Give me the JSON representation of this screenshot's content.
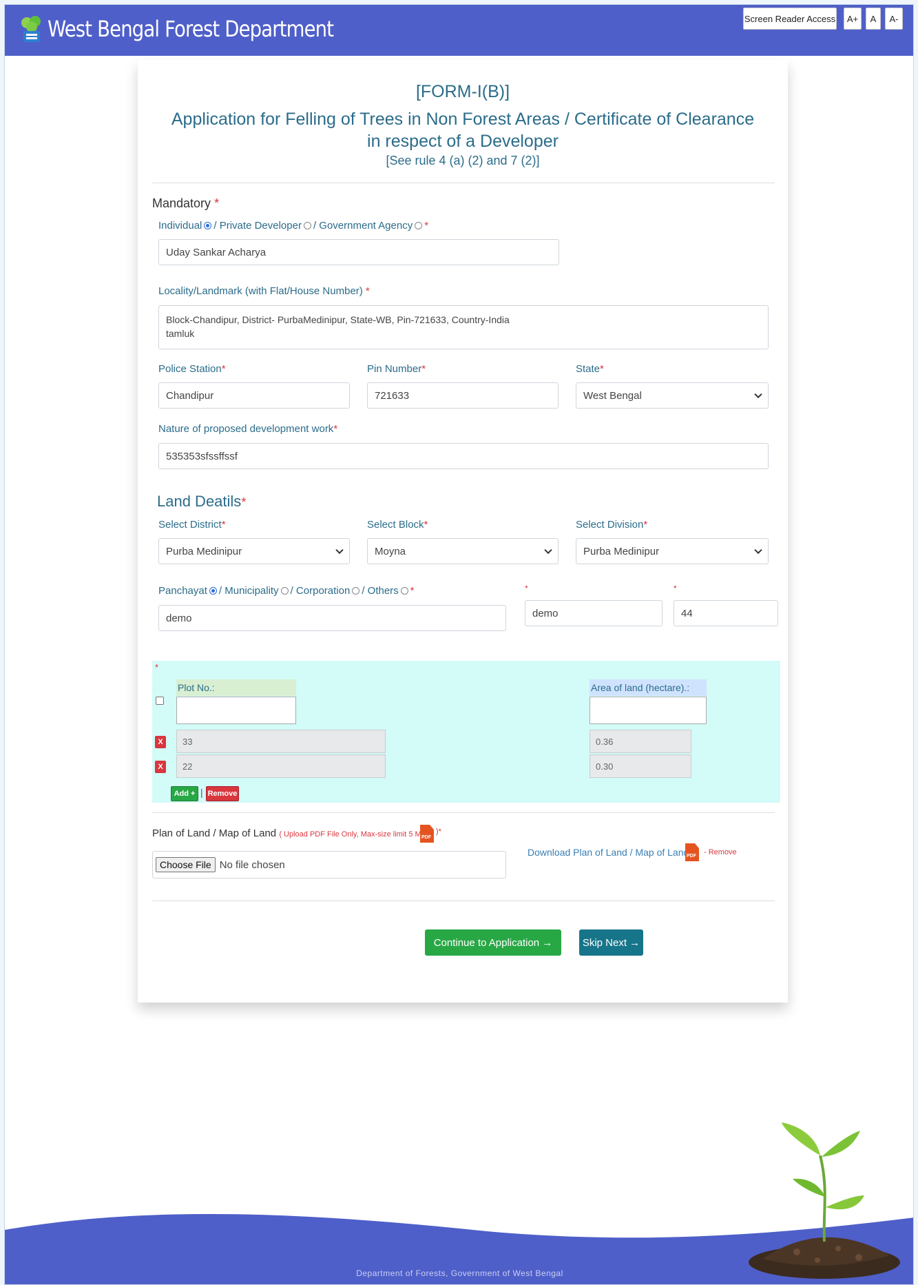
{
  "header": {
    "title": "West Bengal Forest Department",
    "screen_reader": "Screen Reader Access",
    "font_increase": "A+",
    "font_normal": "A",
    "font_decrease": "A-"
  },
  "form": {
    "number": "[FORM-I(B)]",
    "title": "Application for Felling of Trees in Non Forest Areas / Certificate of Clearance in respect of a Developer",
    "rule": "[See rule 4 (a) (2) and 7 (2)]"
  },
  "mandatory": {
    "heading": "Mandatory",
    "applicant_types": [
      "Individual",
      "/ Private Developer",
      "/ Government Agency"
    ],
    "selected_type": "Individual",
    "name_value": "Uday Sankar Acharya",
    "locality_label": "Locality/Landmark (with Flat/House Number)",
    "locality_value": "Block-Chandipur, District- PurbaMedinipur, State-WB, Pin-721633,  Country-India\ntamluk",
    "police_station_label": "Police Station",
    "police_station_value": "Chandipur",
    "pin_label": "Pin Number",
    "pin_value": "721633",
    "state_label": "State",
    "state_value": "West Bengal",
    "nature_label": "Nature of proposed development work",
    "nature_value": "535353sfssffssf"
  },
  "land": {
    "heading": "Land Deatils",
    "district_label": "Select District",
    "district_value": "Purba Medinipur",
    "block_label": "Select Block",
    "block_value": "Moyna",
    "division_label": "Select Division",
    "division_value": "Purba Medinipur",
    "local_body_types": [
      "Panchayat",
      "/ Municipality",
      "/ Corporation",
      "/ Others"
    ],
    "selected_local_body": "Panchayat",
    "local_body_value": "demo",
    "field2_value": "demo",
    "field3_value": "44"
  },
  "plots": {
    "plot_header": "Plot No.:",
    "area_header": "Area of land (hectare).:",
    "new_plot_value": "",
    "new_area_value": "",
    "rows": [
      {
        "plot": "33",
        "area": "0.36"
      },
      {
        "plot": "22",
        "area": "0.30"
      }
    ],
    "remove_row_icon": "X",
    "add_label": "Add +",
    "separator": "|",
    "remove_label": "Remove"
  },
  "upload": {
    "label": "Plan of Land / Map of Land",
    "hint": "( Upload PDF File Only, Max-size limit 5 MB.",
    "hint_close": ")",
    "choose_file": "Choose File",
    "no_file": "No file chosen",
    "download_label": "Download Plan of Land / Map of Land",
    "remove_label": "- Remove",
    "pdf_icon_text": "PDF"
  },
  "actions": {
    "continue_label": "Continue to Application →",
    "skip_label": "Skip Next →"
  },
  "footer": {
    "text": "Department of Forests, Government of West Bengal"
  },
  "colors": {
    "header_bg": "#4f5fc9",
    "accent_text": "#2b6c8a",
    "required": "#d9363e",
    "continue_bg": "#28a745",
    "skip_bg": "#17758a",
    "plot_panel_bg": "#d3fbf8"
  }
}
